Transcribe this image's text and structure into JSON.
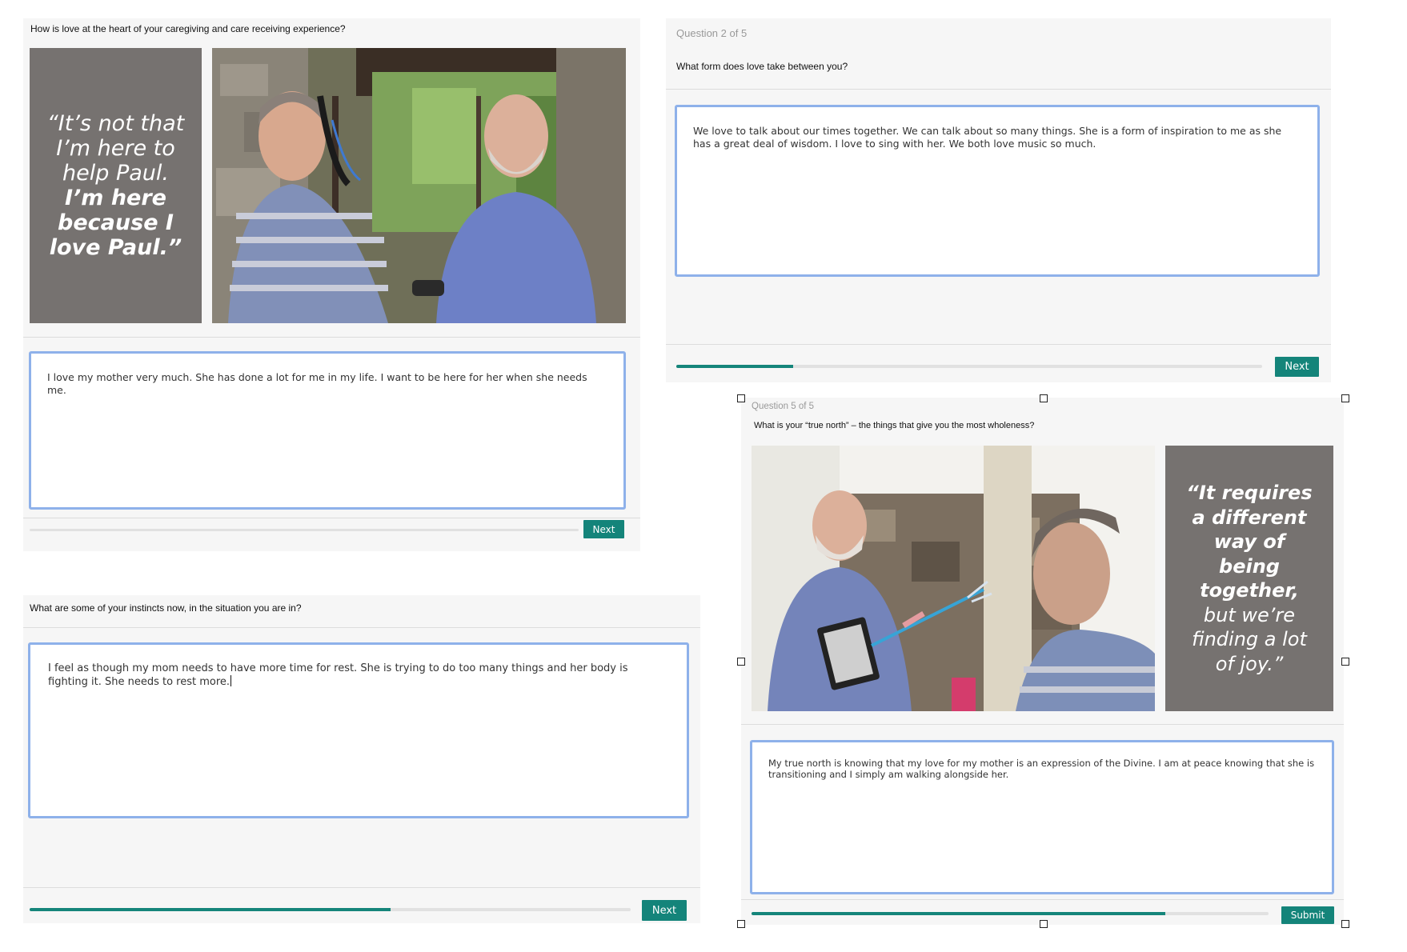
{
  "panel1": {
    "question": "How is love at the heart of your caregiving and care receiving experience?",
    "quote_lines": [
      {
        "text": "“It’s not that",
        "bold": false
      },
      {
        "text": "I’m here to",
        "bold": false
      },
      {
        "text": "help Paul.",
        "bold": false
      },
      {
        "text": "I’m here",
        "bold": true
      },
      {
        "text": "because I",
        "bold": true
      },
      {
        "text": "love Paul.”",
        "bold": true
      }
    ],
    "answer": "I love my mother very much.  She has done a lot for me in my life.  I want to be here for her when she needs me.",
    "progress": 0,
    "button_label": "Next"
  },
  "panel2": {
    "question_number": "Question 2 of 5",
    "question": "What form does love take between you?",
    "answer": "We love to talk about our times together.  We can talk about so many things.  She is a form of inspiration to me as she has a great deal of wisdom.  I love to sing with her.  We both love music so much.",
    "progress": 0.2,
    "button_label": "Next"
  },
  "panel3": {
    "question": "What are some of your instincts now, in the situation you are in?",
    "answer": "I feel as though my mom needs to have more time for rest.  She is trying to do too many things and her body is fighting it.  She needs to rest more.",
    "progress": 0.6,
    "button_label": "Next"
  },
  "panel4": {
    "question_number": "Question 5 of 5",
    "question": "What is your “true north” – the things that give you the most wholeness?",
    "quote_lines": [
      {
        "text": "“It requires",
        "bold": true
      },
      {
        "text": "a different",
        "bold": true
      },
      {
        "text": "way of",
        "bold": true
      },
      {
        "text": "being",
        "bold": true
      },
      {
        "text": "together,",
        "bold": true
      },
      {
        "text": "but we’re",
        "bold": false
      },
      {
        "text": "finding a lot",
        "bold": false
      },
      {
        "text": "of joy.”",
        "bold": false
      }
    ],
    "answer": "My true north is knowing that my love for my mother is an expression of the Divine.  I am at peace knowing that she is transitioning and I simply am walking alongside her.",
    "progress": 0.8,
    "button_label": "Submit"
  },
  "colors": {
    "accent": "#14847a",
    "answer_border": "#8eb1ea",
    "quote_bg": "#767270",
    "panel_bg": "#f6f6f6"
  }
}
